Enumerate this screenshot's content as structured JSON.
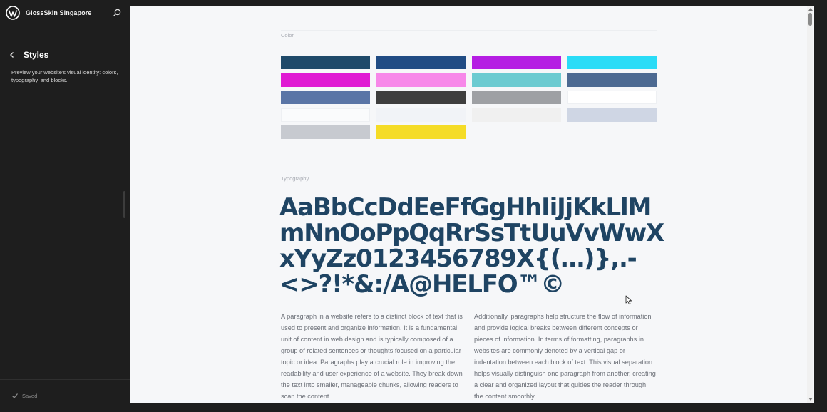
{
  "header": {
    "site_name": "GlossSkin Singapore"
  },
  "panel": {
    "title": "Styles",
    "description": "Preview your website's visual identity: colors, typography, and blocks."
  },
  "footer": {
    "status": "Saved"
  },
  "preview": {
    "color_label": "Color",
    "typography_label": "Typography",
    "swatches": [
      "#1f4a6a",
      "#214c84",
      "#b51ee3",
      "#2adcf7",
      "#e01ad3",
      "#f788e9",
      "#6ccbd1",
      "#4d6a92",
      "#5a75a6",
      "#3e3e3e",
      "#9ea0a4",
      "#ffffff",
      "#fafbfc",
      "#f1f3f7",
      "#f0f0f0",
      "#cfd6e4",
      "#c7cad0",
      "#f5dc27"
    ],
    "specimen": "AaBbCcDdEeFfGgHhIiJjKkLlM\nmNnOoPpQqRrSsTtUuVvWwX\nxYyZz0123456789X{(…)},.-\n<>?!*&:/A@HELFO™©",
    "paragraph_1": "A paragraph in a website refers to a distinct block of text that is used to present and organize information. It is a fundamental unit of content in web design and is typically composed of a group of related sentences or thoughts focused on a particular topic or idea. Paragraphs play a crucial role in improving the readability and user experience of a website. They break down the text into smaller, manageable chunks, allowing readers to scan the content",
    "paragraph_2": "Additionally, paragraphs help structure the flow of information and provide logical breaks between different concepts or pieces of information. In terms of formatting, paragraphs in websites are commonly denoted by a vertical gap or indentation between each block of text. This visual separation helps visually distinguish one paragraph from another, creating a clear and organized layout that guides the reader through the content smoothly."
  }
}
